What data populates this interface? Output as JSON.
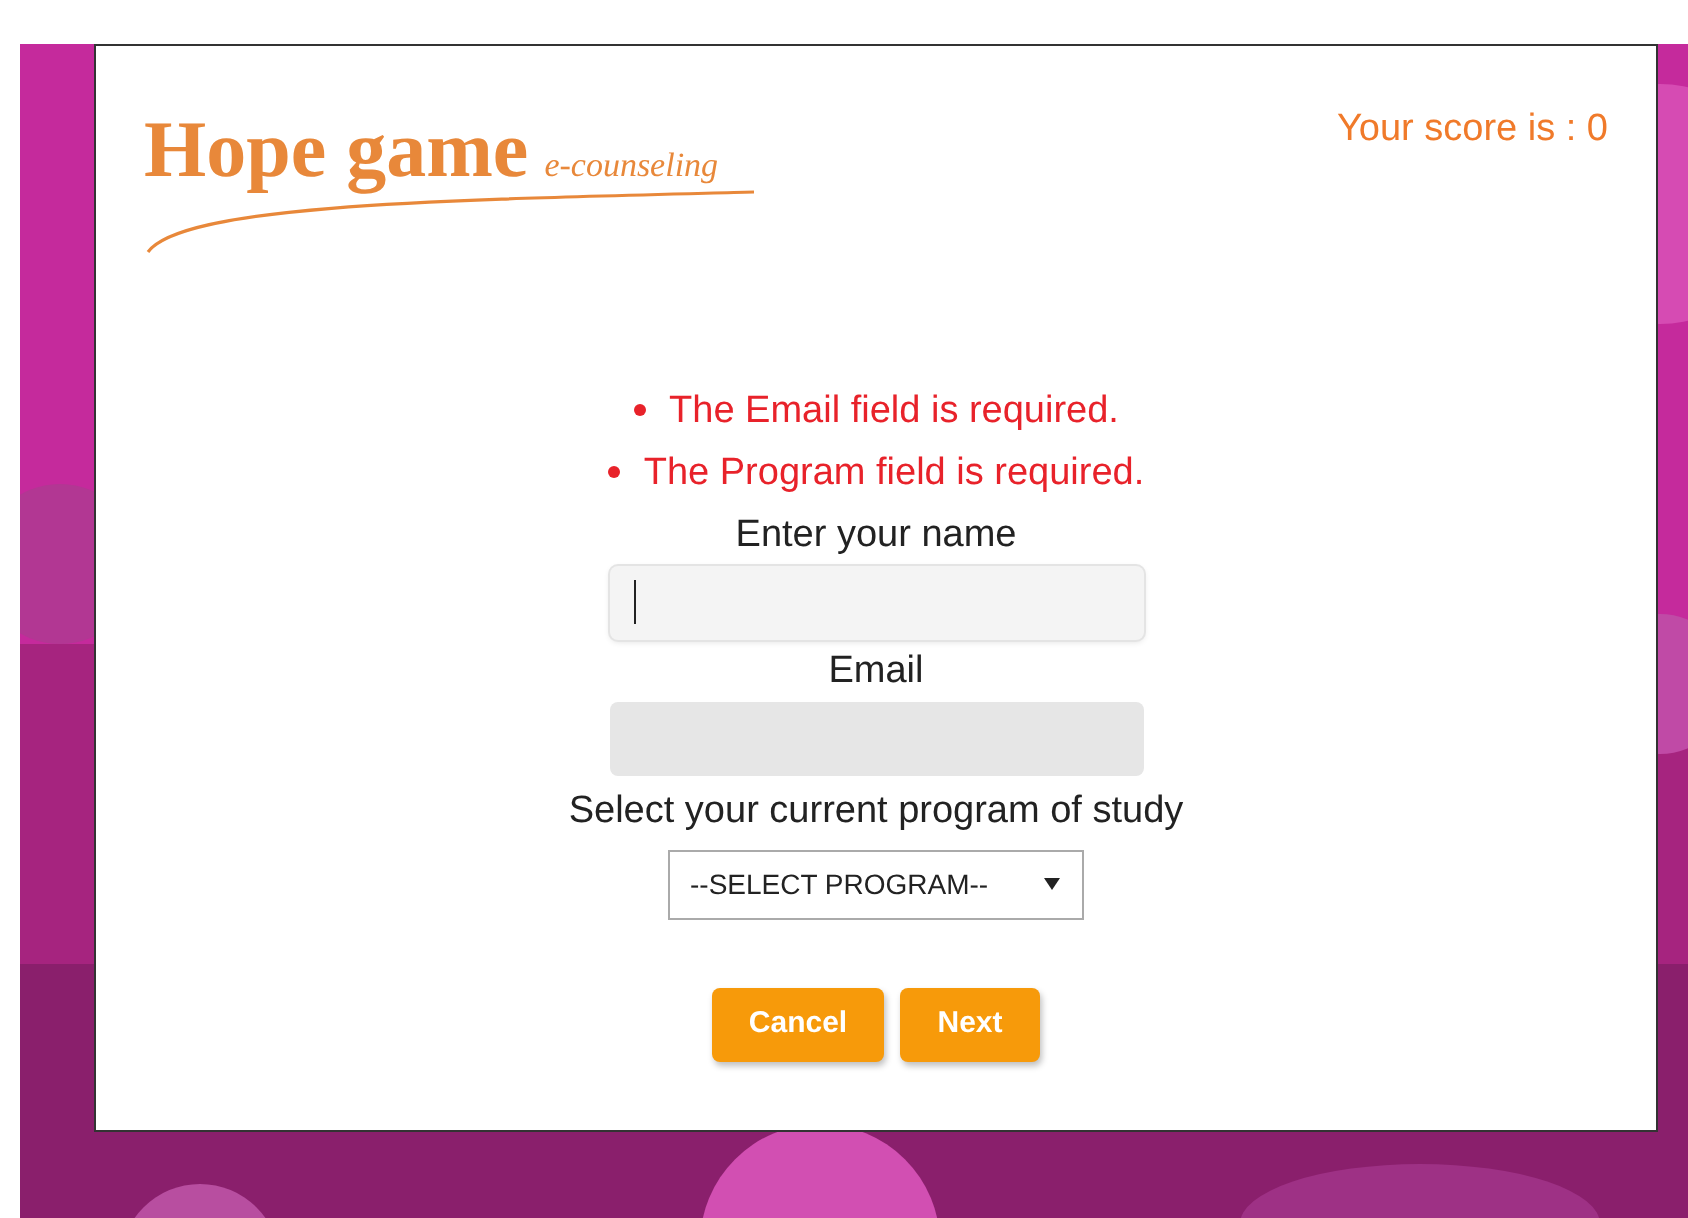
{
  "header": {
    "logo_title": "Hope game",
    "logo_subtitle": "e-counseling",
    "score": "Your score is : 0"
  },
  "errors": [
    "The Email field is required.",
    "The Program field is required."
  ],
  "fields": [
    {
      "label": "Enter your name",
      "focused": true
    },
    {
      "label": "Email",
      "focused": false
    }
  ],
  "program": {
    "label": "Select your current program of study",
    "value": "--SELECT PROGRAM--"
  },
  "buttons": [
    "Cancel",
    "Next"
  ]
}
